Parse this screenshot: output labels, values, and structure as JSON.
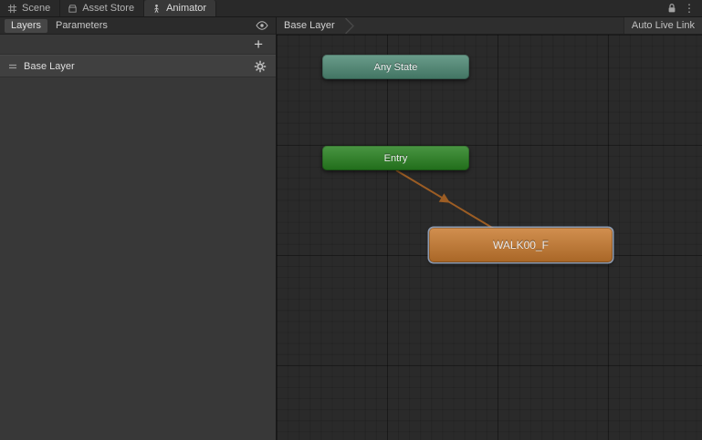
{
  "window": {
    "tabs": [
      {
        "label": "Scene"
      },
      {
        "label": "Asset Store"
      },
      {
        "label": "Animator",
        "active": true
      }
    ]
  },
  "sidebar": {
    "tabs": [
      {
        "label": "Layers",
        "active": true
      },
      {
        "label": "Parameters",
        "active": false
      }
    ],
    "add_button_label": "+",
    "layers": [
      {
        "name": "Base Layer"
      }
    ]
  },
  "graph": {
    "breadcrumb": "Base Layer",
    "auto_live_link_label": "Auto Live Link",
    "nodes": {
      "any_state": {
        "label": "Any State",
        "color": "#4e8a75",
        "selected": false
      },
      "entry": {
        "label": "Entry",
        "color": "#27821f",
        "selected": false
      },
      "walk": {
        "label": "WALK00_F",
        "color": "#c97a2e",
        "selected": true
      }
    },
    "transitions": [
      {
        "from": "Entry",
        "to": "WALK00_F",
        "color": "#9c5d24"
      }
    ]
  }
}
